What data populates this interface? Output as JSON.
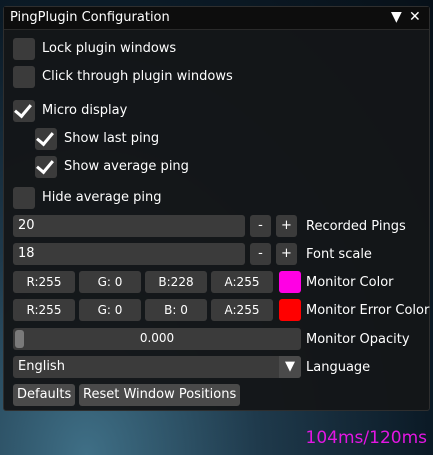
{
  "window": {
    "title": "PingPlugin Configuration",
    "collapse_glyph": "▼",
    "close_glyph": "✕"
  },
  "checkboxes": [
    {
      "label": "Lock plugin windows",
      "checked": false
    },
    {
      "label": "Click through plugin windows",
      "checked": false
    },
    {
      "label": "Micro display",
      "checked": true
    },
    {
      "label": "Show last ping",
      "checked": true
    },
    {
      "label": "Show average ping",
      "checked": true
    },
    {
      "label": "Hide average ping",
      "checked": false
    }
  ],
  "recorded_pings": {
    "value": "20",
    "label": "Recorded Pings",
    "minus": "-",
    "plus": "+"
  },
  "font_scale": {
    "value": "18",
    "label": "Font scale",
    "minus": "-",
    "plus": "+"
  },
  "monitor_color": {
    "label": "Monitor Color",
    "r": "R:255",
    "g": "G:  0",
    "b": "B:228",
    "a": "A:255",
    "swatch": "#ff00e4"
  },
  "monitor_error_color": {
    "label": "Monitor Error Color",
    "r": "R:255",
    "g": "G:  0",
    "b": "B:  0",
    "a": "A:255",
    "swatch": "#ff0000"
  },
  "monitor_opacity": {
    "label": "Monitor Opacity",
    "value": "0.000"
  },
  "language": {
    "label": "Language",
    "selected": "English",
    "arrow_glyph": "▼"
  },
  "buttons": {
    "defaults": "Defaults",
    "reset": "Reset Window Positions"
  },
  "overlay": {
    "ping_text": "104ms/120ms",
    "color": "#e316e3"
  }
}
